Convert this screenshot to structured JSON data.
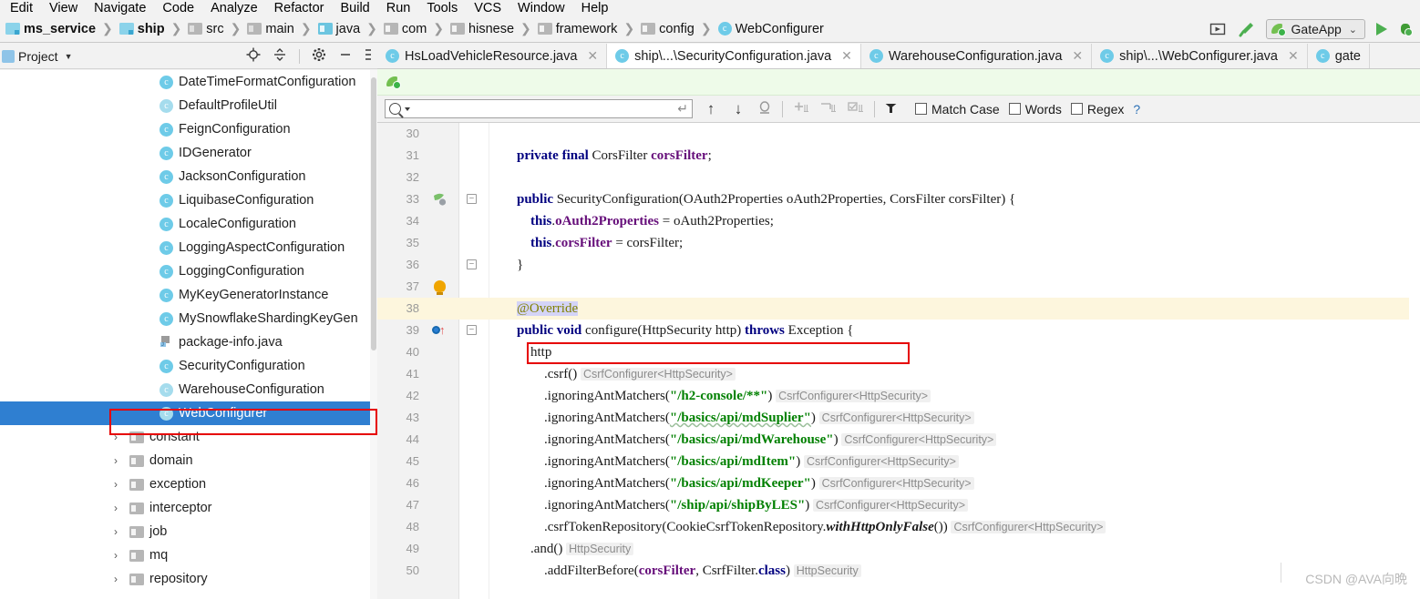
{
  "menu": {
    "items": [
      "Edit",
      "View",
      "Navigate",
      "Code",
      "Analyze",
      "Refactor",
      "Build",
      "Run",
      "Tools",
      "VCS",
      "Window",
      "Help"
    ]
  },
  "breadcrumb": {
    "items": [
      {
        "label": "ms_service",
        "icon": "module-icon",
        "bold": true
      },
      {
        "label": "ship",
        "icon": "module-icon",
        "bold": true
      },
      {
        "label": "src",
        "icon": "folder-icon",
        "bold": false
      },
      {
        "label": "main",
        "icon": "folder-icon",
        "bold": false
      },
      {
        "label": "java",
        "icon": "folder-blue-icon",
        "bold": false
      },
      {
        "label": "com",
        "icon": "folder-icon",
        "bold": false
      },
      {
        "label": "hisnese",
        "icon": "folder-icon",
        "bold": false
      },
      {
        "label": "framework",
        "icon": "folder-icon",
        "bold": false
      },
      {
        "label": "config",
        "icon": "folder-icon",
        "bold": false
      },
      {
        "label": "WebConfigurer",
        "icon": "class-icon",
        "bold": false
      }
    ],
    "separator": "❯"
  },
  "toolbar": {
    "select_in_label": "select-in-icon",
    "build_label": "build-hammer-icon",
    "run_config_name": "GateApp",
    "run_config_caret": "⌄",
    "run_label": "run-icon",
    "debug_label": "debug-icon"
  },
  "project_panel": {
    "title": "Project",
    "caret": "▼",
    "actions": [
      "locate-icon",
      "collapse-all-icon",
      "settings-gear-icon",
      "hide-icon"
    ],
    "tree": [
      {
        "label": "DateTimeFormatConfiguration",
        "icon": "class-icon",
        "indent": 0,
        "arrow": "",
        "selected": false
      },
      {
        "label": "DefaultProfileUtil",
        "icon": "class-icon-pale",
        "indent": 0,
        "arrow": "",
        "selected": false
      },
      {
        "label": "FeignConfiguration",
        "icon": "class-icon",
        "indent": 0,
        "arrow": "",
        "selected": false
      },
      {
        "label": "IDGenerator",
        "icon": "class-icon",
        "indent": 0,
        "arrow": "",
        "selected": false
      },
      {
        "label": "JacksonConfiguration",
        "icon": "class-icon",
        "indent": 0,
        "arrow": "",
        "selected": false
      },
      {
        "label": "LiquibaseConfiguration",
        "icon": "class-icon",
        "indent": 0,
        "arrow": "",
        "selected": false
      },
      {
        "label": "LocaleConfiguration",
        "icon": "class-icon",
        "indent": 0,
        "arrow": "",
        "selected": false
      },
      {
        "label": "LoggingAspectConfiguration",
        "icon": "class-icon",
        "indent": 0,
        "arrow": "",
        "selected": false
      },
      {
        "label": "LoggingConfiguration",
        "icon": "class-icon",
        "indent": 0,
        "arrow": "",
        "selected": false
      },
      {
        "label": "MyKeyGeneratorInstance",
        "icon": "class-icon",
        "indent": 0,
        "arrow": "",
        "selected": false
      },
      {
        "label": "MySnowflakeShardingKeyGen",
        "icon": "class-icon",
        "indent": 0,
        "arrow": "",
        "selected": false
      },
      {
        "label": "package-info.java",
        "icon": "package-info-icon",
        "indent": 0,
        "arrow": "",
        "selected": false
      },
      {
        "label": "SecurityConfiguration",
        "icon": "class-icon",
        "indent": 0,
        "arrow": "",
        "selected": false
      },
      {
        "label": "WarehouseConfiguration",
        "icon": "class-icon-pale",
        "indent": 0,
        "arrow": "",
        "selected": false
      },
      {
        "label": "WebConfigurer",
        "icon": "class-icon-pale",
        "indent": 0,
        "arrow": "",
        "selected": true
      },
      {
        "label": "constant",
        "icon": "folder-icon",
        "indent": -1,
        "arrow": "›",
        "selected": false
      },
      {
        "label": "domain",
        "icon": "folder-icon",
        "indent": -1,
        "arrow": "›",
        "selected": false
      },
      {
        "label": "exception",
        "icon": "folder-icon",
        "indent": -1,
        "arrow": "›",
        "selected": false
      },
      {
        "label": "interceptor",
        "icon": "folder-icon",
        "indent": -1,
        "arrow": "›",
        "selected": false
      },
      {
        "label": "job",
        "icon": "folder-icon",
        "indent": -1,
        "arrow": "›",
        "selected": false
      },
      {
        "label": "mq",
        "icon": "folder-icon",
        "indent": -1,
        "arrow": "›",
        "selected": false
      },
      {
        "label": "repository",
        "icon": "folder-icon",
        "indent": -1,
        "arrow": "›",
        "selected": false
      }
    ]
  },
  "editor_tabs": [
    {
      "label": "HsLoadVehicleResource.java",
      "icon": "class-icon",
      "active": false,
      "closable": true
    },
    {
      "label": "ship\\...\\SecurityConfiguration.java",
      "icon": "class-icon",
      "active": true,
      "closable": true
    },
    {
      "label": "WarehouseConfiguration.java",
      "icon": "class-icon",
      "active": false,
      "closable": true
    },
    {
      "label": "ship\\...\\WebConfigurer.java",
      "icon": "class-icon",
      "active": false,
      "closable": true
    },
    {
      "label": "gate",
      "icon": "class-icon",
      "active": false,
      "closable": false
    }
  ],
  "find_bar": {
    "search_value": "",
    "search_placeholder": "",
    "enter_hint": "↵",
    "prev_label": "↑",
    "next_label": "↓",
    "select_all_label": "select-all-occurrences-icon",
    "add_label": "add-occurrence-icon",
    "exclude_label": "exclude-occurrence-icon",
    "toggle_label": "toggle-occurrence-icon",
    "filter_label": "filter-icon",
    "match_case": {
      "label": "Match Case",
      "checked": false
    },
    "words": {
      "label": "Words",
      "checked": false
    },
    "regex": {
      "label": "Regex",
      "checked": false
    },
    "help": "?"
  },
  "code": {
    "lines": [
      {
        "no": "30",
        "html": ""
      },
      {
        "no": "31",
        "html": "        <span class='kw'>private final</span> CorsFilter <span class='fld'>corsFilter</span>;"
      },
      {
        "no": "32",
        "html": ""
      },
      {
        "no": "33",
        "html": "        <span class='kw'>public</span> SecurityConfiguration(OAuth2Properties oAuth2Properties, CorsFilter corsFilter) {",
        "gutter": "run-method-icon",
        "fold": "−"
      },
      {
        "no": "34",
        "html": "            <span class='kw'>this</span>.<span class='fld'>oAuth2Properties</span> = oAuth2Properties;"
      },
      {
        "no": "35",
        "html": "            <span class='kw'>this</span>.<span class='fld'>corsFilter</span> = corsFilter;"
      },
      {
        "no": "36",
        "html": "        }",
        "fold": "−"
      },
      {
        "no": "37",
        "html": "",
        "gutter": "intention-bulb-icon"
      },
      {
        "no": "38",
        "html": "        <span class='ann ann-sel'>@Override</span>",
        "highlight": true
      },
      {
        "no": "39",
        "html": "        <span class='kw'>public void</span> configure(HttpSecurity http) <span class='kw'>throws</span> Exception {",
        "gutter": "override-marker-icon",
        "fold": "−"
      },
      {
        "no": "40",
        "html": "            http"
      },
      {
        "no": "41",
        "html": "                .csrf() <span class='hint'>CsrfConfigurer&lt;HttpSecurity&gt;</span>"
      },
      {
        "no": "42",
        "html": "                .ignoringAntMatchers(<span class='str'>\"/h2-console/**\"</span>) <span class='hint'>CsrfConfigurer&lt;HttpSecurity&gt;</span>"
      },
      {
        "no": "43",
        "html": "                .ignoringAntMatchers(<span class='str squiggle'>\"/basics/api/mdSuplier\"</span>) <span class='hint'>CsrfConfigurer&lt;HttpSecurity&gt;</span>"
      },
      {
        "no": "44",
        "html": "                .ignoringAntMatchers(<span class='str'>\"/basics/api/mdWarehouse\"</span>) <span class='hint'>CsrfConfigurer&lt;HttpSecurity&gt;</span>"
      },
      {
        "no": "45",
        "html": "                .ignoringAntMatchers(<span class='str'>\"/basics/api/mdItem\"</span>) <span class='hint'>CsrfConfigurer&lt;HttpSecurity&gt;</span>"
      },
      {
        "no": "46",
        "html": "                .ignoringAntMatchers(<span class='str'>\"/basics/api/mdKeeper\"</span>) <span class='hint'>CsrfConfigurer&lt;HttpSecurity&gt;</span>"
      },
      {
        "no": "47",
        "html": "                .ignoringAntMatchers(<span class='str'>\"/ship/api/shipByLES\"</span>) <span class='hint'>CsrfConfigurer&lt;HttpSecurity&gt;</span>"
      },
      {
        "no": "48",
        "html": "                .csrfTokenRepository(CookieCsrfTokenRepository.<span class='ital'>withHttpOnlyFalse</span>()) <span class='hint'>CsrfConfigurer&lt;HttpSecurity&gt;</span>"
      },
      {
        "no": "49",
        "html": "            .and() <span class='hint'>HttpSecurity</span>"
      },
      {
        "no": "50",
        "html": "                .addFilterBefore(<span class='fld'>corsFilter</span>, CsrfFilter.<span class='kw'>class</span>) <span class='hint'>HttpSecurity</span>"
      }
    ],
    "highlight_box_line": "47"
  },
  "watermark": {
    "text": "CSDN @AVA向晩"
  },
  "colors": {
    "selection_blue": "#2f7fd1",
    "highlight_red": "#e60000",
    "string_green": "#008000",
    "keyword_navy": "#000080",
    "field_purple": "#660e7a",
    "line_highlight": "#fdf6dd",
    "find_strip_green": "#eefbe9"
  }
}
